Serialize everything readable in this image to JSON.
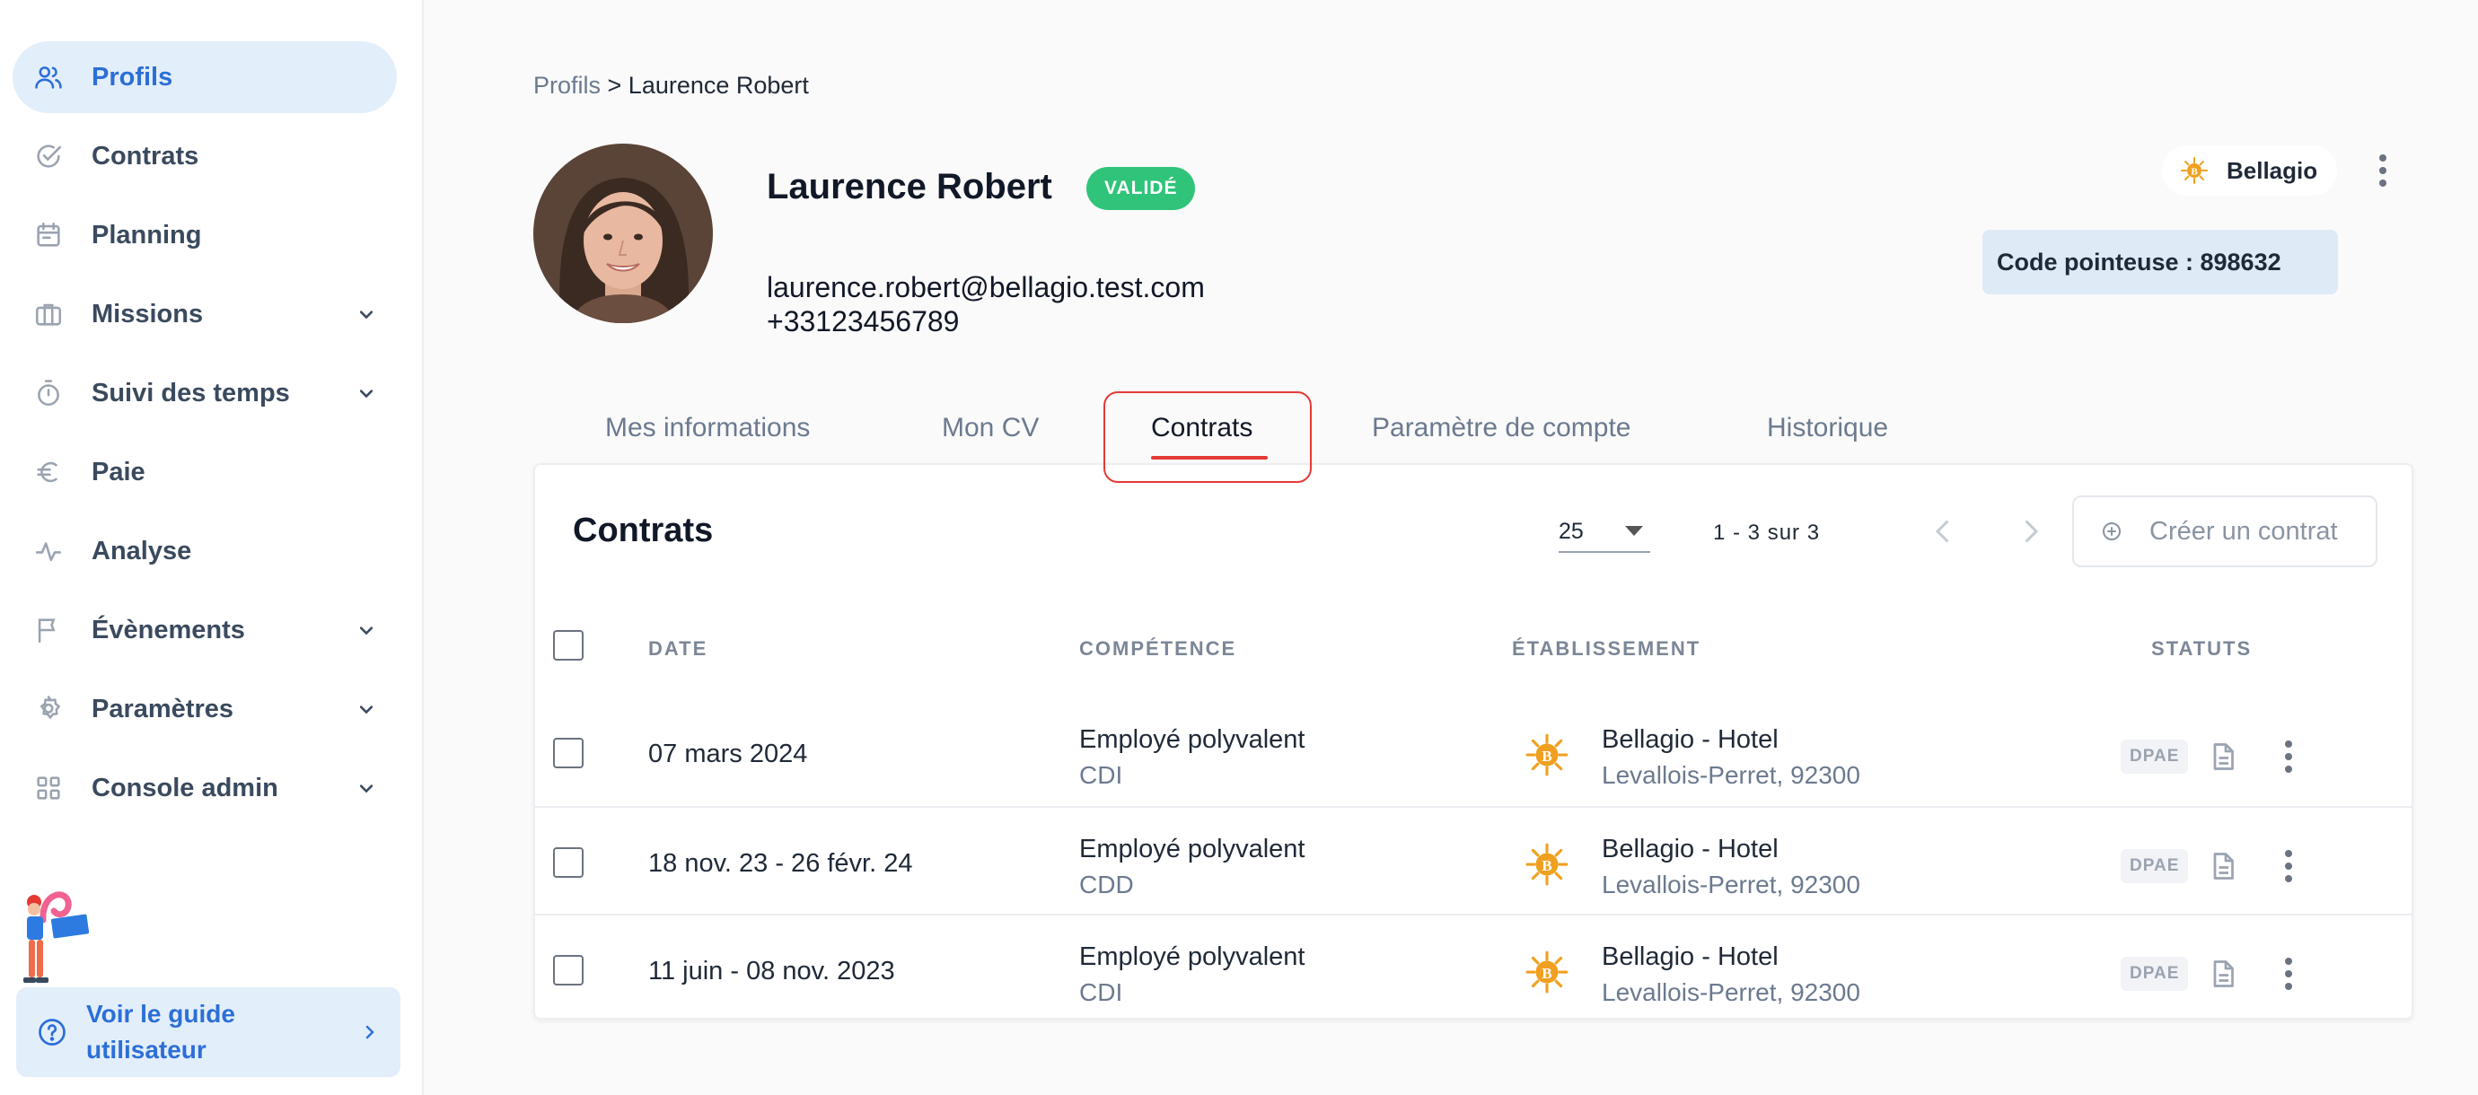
{
  "sidebar": {
    "items": [
      {
        "label": "Profils",
        "icon": "users-icon",
        "active": true
      },
      {
        "label": "Contrats",
        "icon": "check-circle-icon"
      },
      {
        "label": "Planning",
        "icon": "calendar-icon"
      },
      {
        "label": "Missions",
        "icon": "briefcase-icon",
        "expandable": true
      },
      {
        "label": "Suivi des temps",
        "icon": "stopwatch-icon",
        "expandable": true
      },
      {
        "label": "Paie",
        "icon": "euro-icon"
      },
      {
        "label": "Analyse",
        "icon": "activity-icon"
      },
      {
        "label": "Évènements",
        "icon": "flag-icon",
        "expandable": true
      },
      {
        "label": "Paramètres",
        "icon": "settings-icon",
        "expandable": true
      },
      {
        "label": "Console admin",
        "icon": "grid-icon",
        "expandable": true
      }
    ],
    "guide_label": "Voir le guide utilisateur"
  },
  "breadcrumb": {
    "root": "Profils",
    "separator": " > ",
    "current": "Laurence Robert"
  },
  "profile": {
    "name": "Laurence Robert",
    "status": "VALIDÉ",
    "email": "laurence.robert@bellagio.test.com",
    "phone": "+33123456789"
  },
  "org": {
    "name": "Bellagio"
  },
  "code_pointeuse": "Code pointeuse : 898632",
  "tabs": [
    {
      "label": "Mes informations"
    },
    {
      "label": "Mon CV"
    },
    {
      "label": "Contrats",
      "active": true
    },
    {
      "label": "Paramètre de compte"
    },
    {
      "label": "Historique"
    }
  ],
  "contracts": {
    "title": "Contrats",
    "per_page": "25",
    "page_info": "1 - 3 sur 3",
    "create_label": "Créer un contrat",
    "headers": {
      "date": "DATE",
      "skill": "COMPÉTENCE",
      "establishment": "ÉTABLISSEMENT",
      "status": "STATUTS"
    },
    "rows": [
      {
        "date": "07 mars 2024",
        "skill": "Employé polyvalent",
        "type": "CDI",
        "est_name": "Bellagio - Hotel",
        "est_addr": "Levallois-Perret, 92300",
        "dpae": "DPAE"
      },
      {
        "date": "18 nov. 23 - 26 févr. 24",
        "skill": "Employé polyvalent",
        "type": "CDD",
        "est_name": "Bellagio - Hotel",
        "est_addr": "Levallois-Perret, 92300",
        "dpae": "DPAE"
      },
      {
        "date": "11 juin - 08 nov. 2023",
        "skill": "Employé polyvalent",
        "type": "CDI",
        "est_name": "Bellagio - Hotel",
        "est_addr": "Levallois-Perret, 92300",
        "dpae": "DPAE"
      }
    ]
  },
  "colors": {
    "accent": "#2c6fd6",
    "validated": "#2fc47a",
    "highlight": "#e53935",
    "brand_gold": "#f0a020"
  }
}
